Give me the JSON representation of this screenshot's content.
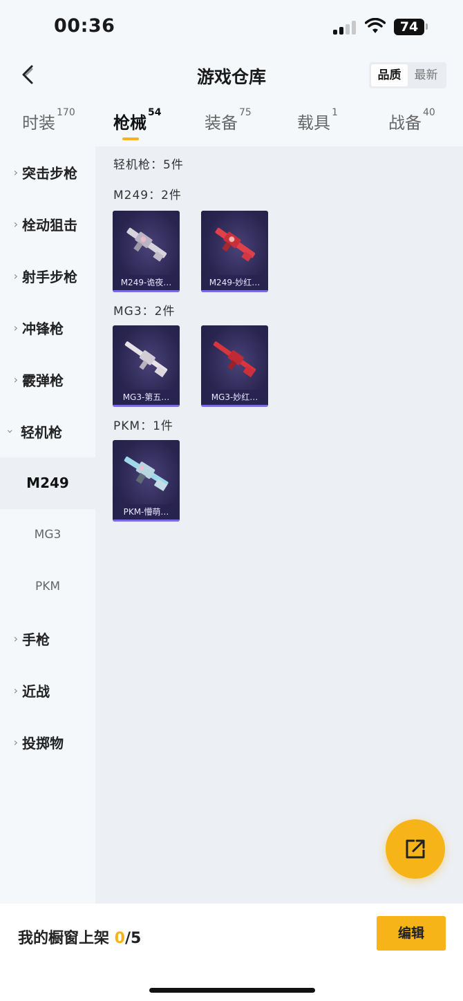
{
  "status": {
    "time": "00:36",
    "battery": "74"
  },
  "nav": {
    "title": "游戏仓库",
    "sort_quality": "品质",
    "sort_newest": "最新"
  },
  "tabs": [
    {
      "label": "时装",
      "count": "170"
    },
    {
      "label": "枪械",
      "count": "54"
    },
    {
      "label": "装备",
      "count": "75"
    },
    {
      "label": "载具",
      "count": "1"
    },
    {
      "label": "战备",
      "count": "40"
    }
  ],
  "sidebar": {
    "assault": "突击步枪",
    "bolt": "栓动狙击",
    "marksman": "射手步枪",
    "smg": "冲锋枪",
    "shotgun": "霰弹枪",
    "lmg": "轻机枪",
    "sub_m249": "M249",
    "sub_mg3": "MG3",
    "sub_pkm": "PKM",
    "pistol": "手枪",
    "melee": "近战",
    "throwable": "投掷物"
  },
  "content": {
    "summary": "轻机枪：5件",
    "groups": [
      {
        "title": "M249：2件",
        "items": [
          "M249-诡夜…",
          "M249-妙红…"
        ]
      },
      {
        "title": "MG3：2件",
        "items": [
          "MG3-第五…",
          "MG3-妙红…"
        ]
      },
      {
        "title": "PKM：1件",
        "items": [
          "PKM-懵萌…"
        ]
      }
    ]
  },
  "footer": {
    "label": "我的橱窗上架 ",
    "current": "0",
    "total": "/5",
    "edit": "编辑"
  },
  "icons": {
    "back": "chevron-left-icon",
    "share": "external-link-icon"
  }
}
